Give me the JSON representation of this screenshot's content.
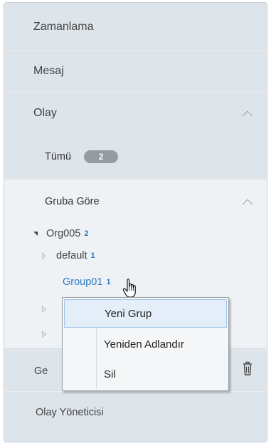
{
  "nav": {
    "zamanlama": "Zamanlama",
    "mesaj": "Mesaj",
    "olay": "Olay"
  },
  "olay_sub": {
    "tumu_label": "Tümü",
    "tumu_count": "2",
    "group_by_label": "Gruba Göre"
  },
  "tree": {
    "root": {
      "label": "Org005",
      "count": "2"
    },
    "children": [
      {
        "label": "default",
        "count": "1"
      },
      {
        "label": "Group01",
        "count": "1"
      }
    ]
  },
  "bottom": {
    "partial_label": "Ge",
    "manager_label": "Olay Yöneticisi"
  },
  "context_menu": {
    "items": [
      "Yeni Grup",
      "Yeniden Adlandır",
      "Sil"
    ]
  },
  "colors": {
    "panel_bg": "#dde4ea",
    "group_bg": "#eef2f5",
    "accent": "#2b78c4",
    "badge": "#939ba3"
  },
  "icons": {
    "chevron": "chevron-up-icon",
    "expand": "triangle-down-icon",
    "collapse": "triangle-right-icon",
    "trash": "trash-icon",
    "cursor": "hand-pointer-icon"
  }
}
